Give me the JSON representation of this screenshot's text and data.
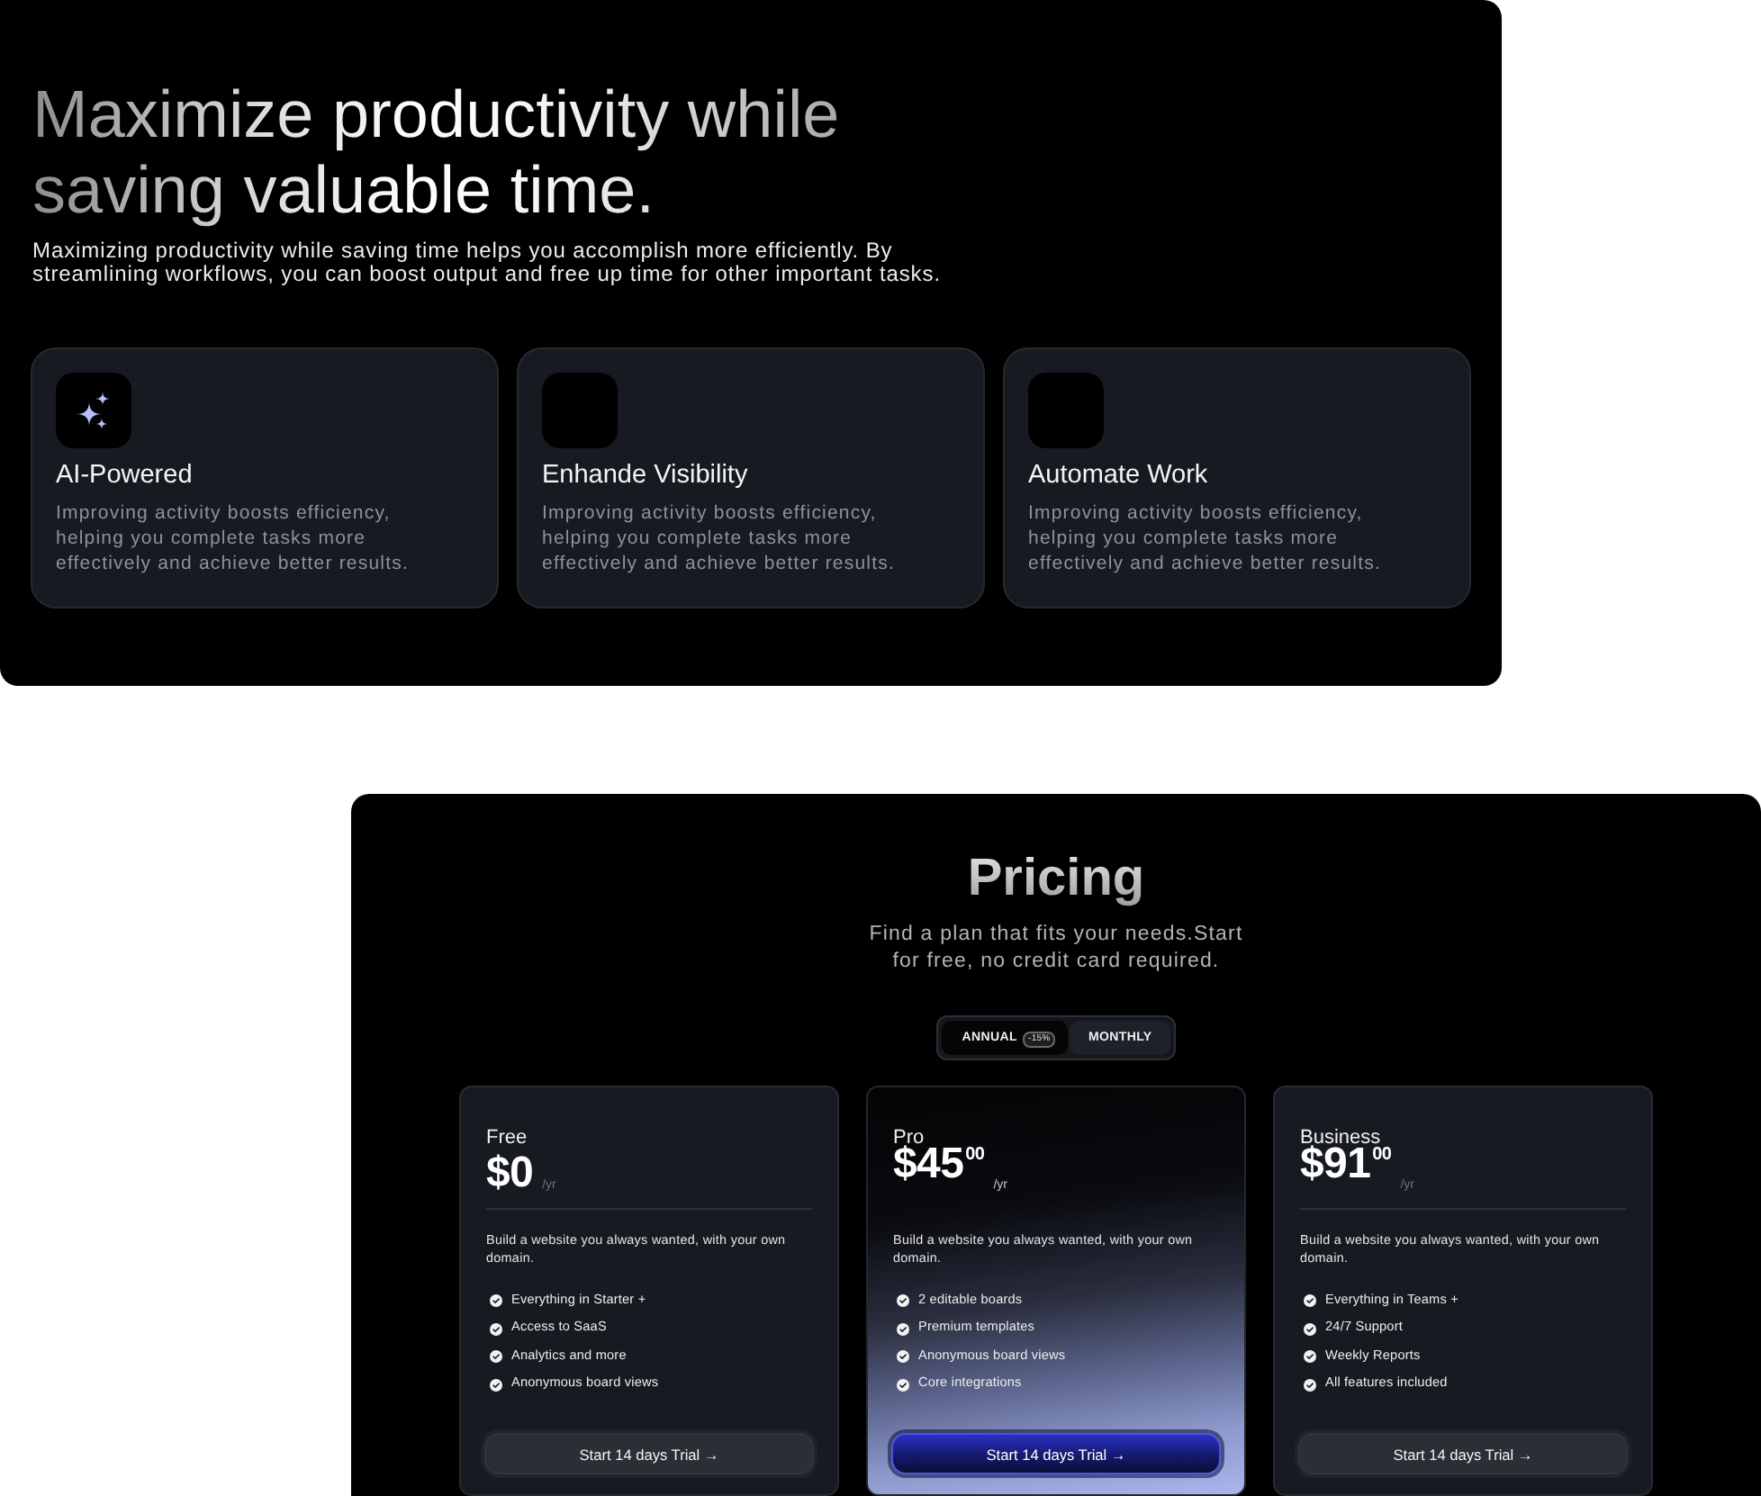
{
  "hero": {
    "title": "Maximize productivity while saving valuable time.",
    "description": "Maximizing productivity while saving time helps you accomplish more efficiently. By streamlining workflows, you can boost output and free up time for other important tasks."
  },
  "features": [
    {
      "kind": "sparkles",
      "title": "AI-Powered",
      "description": "Improving activity boosts efficiency, helping you complete tasks more effectively and achieve better results."
    },
    {
      "kind": "blank",
      "title": "Enhande Visibility",
      "description": "Improving activity boosts efficiency, helping you complete tasks more effectively and achieve better results."
    },
    {
      "kind": "blank",
      "title": "Automate Work",
      "description": "Improving activity boosts efficiency, helping you complete tasks more effectively and achieve better results."
    }
  ],
  "pricing": {
    "title": "Pricing",
    "subtitle": "Find a plan that fits your needs.Start for free, no credit card required.",
    "billing_toggle": [
      {
        "label": "ANNUAL",
        "badge": "-15%",
        "selected": true
      },
      {
        "label": "MONTHLY",
        "selected": false
      }
    ],
    "plans": [
      {
        "name": "Free",
        "price": "$0",
        "period": "/yr",
        "featured": false,
        "description": "Build a website you always wanted, with your own domain.",
        "features": [
          "Everything in Starter +",
          "Access to SaaS",
          "Analytics and more",
          "Anonymous board views"
        ],
        "button": "Start 14 days Trial →"
      },
      {
        "name": "Pro",
        "price": "$45$^{00}$",
        "period": "/yr",
        "featured": true,
        "description": "Build a website you always wanted, with your own domain.",
        "features": [
          "2 editable boards",
          "Premium templates",
          "Anonymous board views",
          "Core integrations"
        ],
        "button": "Start 14 days Trial →"
      },
      {
        "name": "Business",
        "price": "$91$^{00}$",
        "period": "/yr",
        "featured": false,
        "description": "Build a website you always wanted, with your own domain.",
        "features": [
          "Everything in Teams +",
          "24/7 Support",
          "Weekly Reports",
          "All features included"
        ],
        "button": "Start 14 days Trial →"
      }
    ]
  }
}
